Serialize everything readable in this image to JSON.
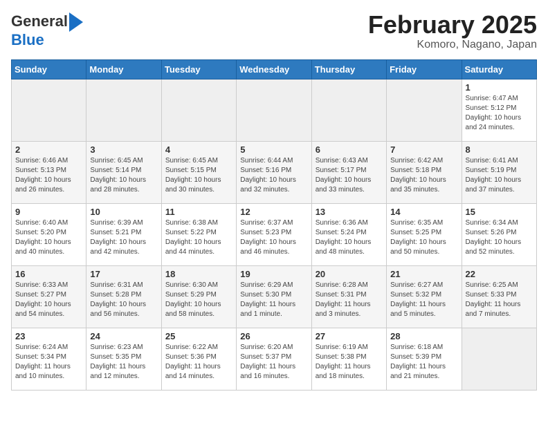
{
  "header": {
    "logo_line1": "General",
    "logo_line2": "Blue",
    "title": "February 2025",
    "subtitle": "Komoro, Nagano, Japan"
  },
  "weekdays": [
    "Sunday",
    "Monday",
    "Tuesday",
    "Wednesday",
    "Thursday",
    "Friday",
    "Saturday"
  ],
  "weeks": [
    [
      {
        "day": "",
        "empty": true
      },
      {
        "day": "",
        "empty": true
      },
      {
        "day": "",
        "empty": true
      },
      {
        "day": "",
        "empty": true
      },
      {
        "day": "",
        "empty": true
      },
      {
        "day": "",
        "empty": true
      },
      {
        "day": "1",
        "sunrise": "6:47 AM",
        "sunset": "5:12 PM",
        "daylight": "10 hours and 24 minutes."
      }
    ],
    [
      {
        "day": "2",
        "sunrise": "6:46 AM",
        "sunset": "5:13 PM",
        "daylight": "10 hours and 26 minutes."
      },
      {
        "day": "3",
        "sunrise": "6:45 AM",
        "sunset": "5:14 PM",
        "daylight": "10 hours and 28 minutes."
      },
      {
        "day": "4",
        "sunrise": "6:45 AM",
        "sunset": "5:15 PM",
        "daylight": "10 hours and 30 minutes."
      },
      {
        "day": "5",
        "sunrise": "6:44 AM",
        "sunset": "5:16 PM",
        "daylight": "10 hours and 32 minutes."
      },
      {
        "day": "6",
        "sunrise": "6:43 AM",
        "sunset": "5:17 PM",
        "daylight": "10 hours and 33 minutes."
      },
      {
        "day": "7",
        "sunrise": "6:42 AM",
        "sunset": "5:18 PM",
        "daylight": "10 hours and 35 minutes."
      },
      {
        "day": "8",
        "sunrise": "6:41 AM",
        "sunset": "5:19 PM",
        "daylight": "10 hours and 37 minutes."
      }
    ],
    [
      {
        "day": "9",
        "sunrise": "6:40 AM",
        "sunset": "5:20 PM",
        "daylight": "10 hours and 40 minutes."
      },
      {
        "day": "10",
        "sunrise": "6:39 AM",
        "sunset": "5:21 PM",
        "daylight": "10 hours and 42 minutes."
      },
      {
        "day": "11",
        "sunrise": "6:38 AM",
        "sunset": "5:22 PM",
        "daylight": "10 hours and 44 minutes."
      },
      {
        "day": "12",
        "sunrise": "6:37 AM",
        "sunset": "5:23 PM",
        "daylight": "10 hours and 46 minutes."
      },
      {
        "day": "13",
        "sunrise": "6:36 AM",
        "sunset": "5:24 PM",
        "daylight": "10 hours and 48 minutes."
      },
      {
        "day": "14",
        "sunrise": "6:35 AM",
        "sunset": "5:25 PM",
        "daylight": "10 hours and 50 minutes."
      },
      {
        "day": "15",
        "sunrise": "6:34 AM",
        "sunset": "5:26 PM",
        "daylight": "10 hours and 52 minutes."
      }
    ],
    [
      {
        "day": "16",
        "sunrise": "6:33 AM",
        "sunset": "5:27 PM",
        "daylight": "10 hours and 54 minutes."
      },
      {
        "day": "17",
        "sunrise": "6:31 AM",
        "sunset": "5:28 PM",
        "daylight": "10 hours and 56 minutes."
      },
      {
        "day": "18",
        "sunrise": "6:30 AM",
        "sunset": "5:29 PM",
        "daylight": "10 hours and 58 minutes."
      },
      {
        "day": "19",
        "sunrise": "6:29 AM",
        "sunset": "5:30 PM",
        "daylight": "11 hours and 1 minute."
      },
      {
        "day": "20",
        "sunrise": "6:28 AM",
        "sunset": "5:31 PM",
        "daylight": "11 hours and 3 minutes."
      },
      {
        "day": "21",
        "sunrise": "6:27 AM",
        "sunset": "5:32 PM",
        "daylight": "11 hours and 5 minutes."
      },
      {
        "day": "22",
        "sunrise": "6:25 AM",
        "sunset": "5:33 PM",
        "daylight": "11 hours and 7 minutes."
      }
    ],
    [
      {
        "day": "23",
        "sunrise": "6:24 AM",
        "sunset": "5:34 PM",
        "daylight": "11 hours and 10 minutes."
      },
      {
        "day": "24",
        "sunrise": "6:23 AM",
        "sunset": "5:35 PM",
        "daylight": "11 hours and 12 minutes."
      },
      {
        "day": "25",
        "sunrise": "6:22 AM",
        "sunset": "5:36 PM",
        "daylight": "11 hours and 14 minutes."
      },
      {
        "day": "26",
        "sunrise": "6:20 AM",
        "sunset": "5:37 PM",
        "daylight": "11 hours and 16 minutes."
      },
      {
        "day": "27",
        "sunrise": "6:19 AM",
        "sunset": "5:38 PM",
        "daylight": "11 hours and 18 minutes."
      },
      {
        "day": "28",
        "sunrise": "6:18 AM",
        "sunset": "5:39 PM",
        "daylight": "11 hours and 21 minutes."
      },
      {
        "day": "",
        "empty": true
      }
    ]
  ]
}
